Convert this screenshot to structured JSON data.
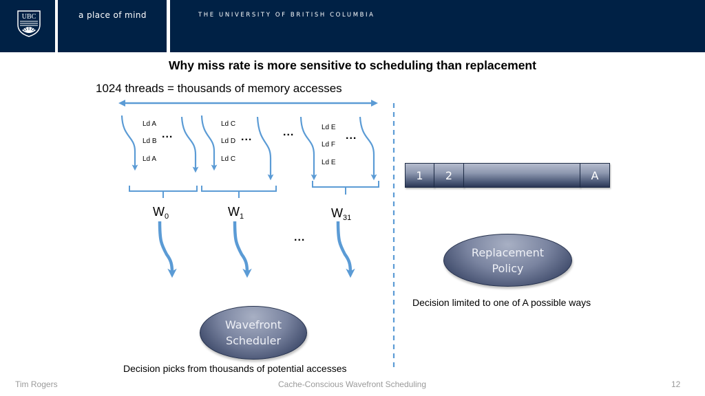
{
  "header": {
    "tagline": "a place of mind",
    "university": "THE UNIVERSITY OF BRITISH COLUMBIA",
    "logo_text": "UBC",
    "brand_color": "#002145"
  },
  "slide": {
    "title": "Why miss rate is more sensitive to scheduling than replacement",
    "subtitle": "1024 threads = thousands of memory accesses",
    "warps": [
      {
        "name": "W",
        "index": "0",
        "loads": [
          "Ld A",
          "Ld B",
          "Ld A"
        ]
      },
      {
        "name": "W",
        "index": "1",
        "loads": [
          "Ld C",
          "Ld D",
          "Ld C"
        ]
      },
      {
        "name": "W",
        "index": "31",
        "loads": [
          "Ld E",
          "Ld F",
          "Ld E"
        ]
      }
    ],
    "ellipsis": "...",
    "cache_ways": [
      "1",
      "2",
      "",
      "A"
    ],
    "replacement_policy": {
      "line1": "Replacement",
      "line2": "Policy"
    },
    "wavefront_scheduler": {
      "line1": "Wavefront",
      "line2": "Scheduler"
    },
    "replacement_caption": "Decision limited to one of A possible ways",
    "scheduler_caption": "Decision picks from thousands of potential accesses",
    "arrow_color": "#5b9bd5"
  },
  "footer": {
    "author": "Tim Rogers",
    "talk_title": "Cache-Conscious Wavefront Scheduling",
    "page_number": "12"
  }
}
